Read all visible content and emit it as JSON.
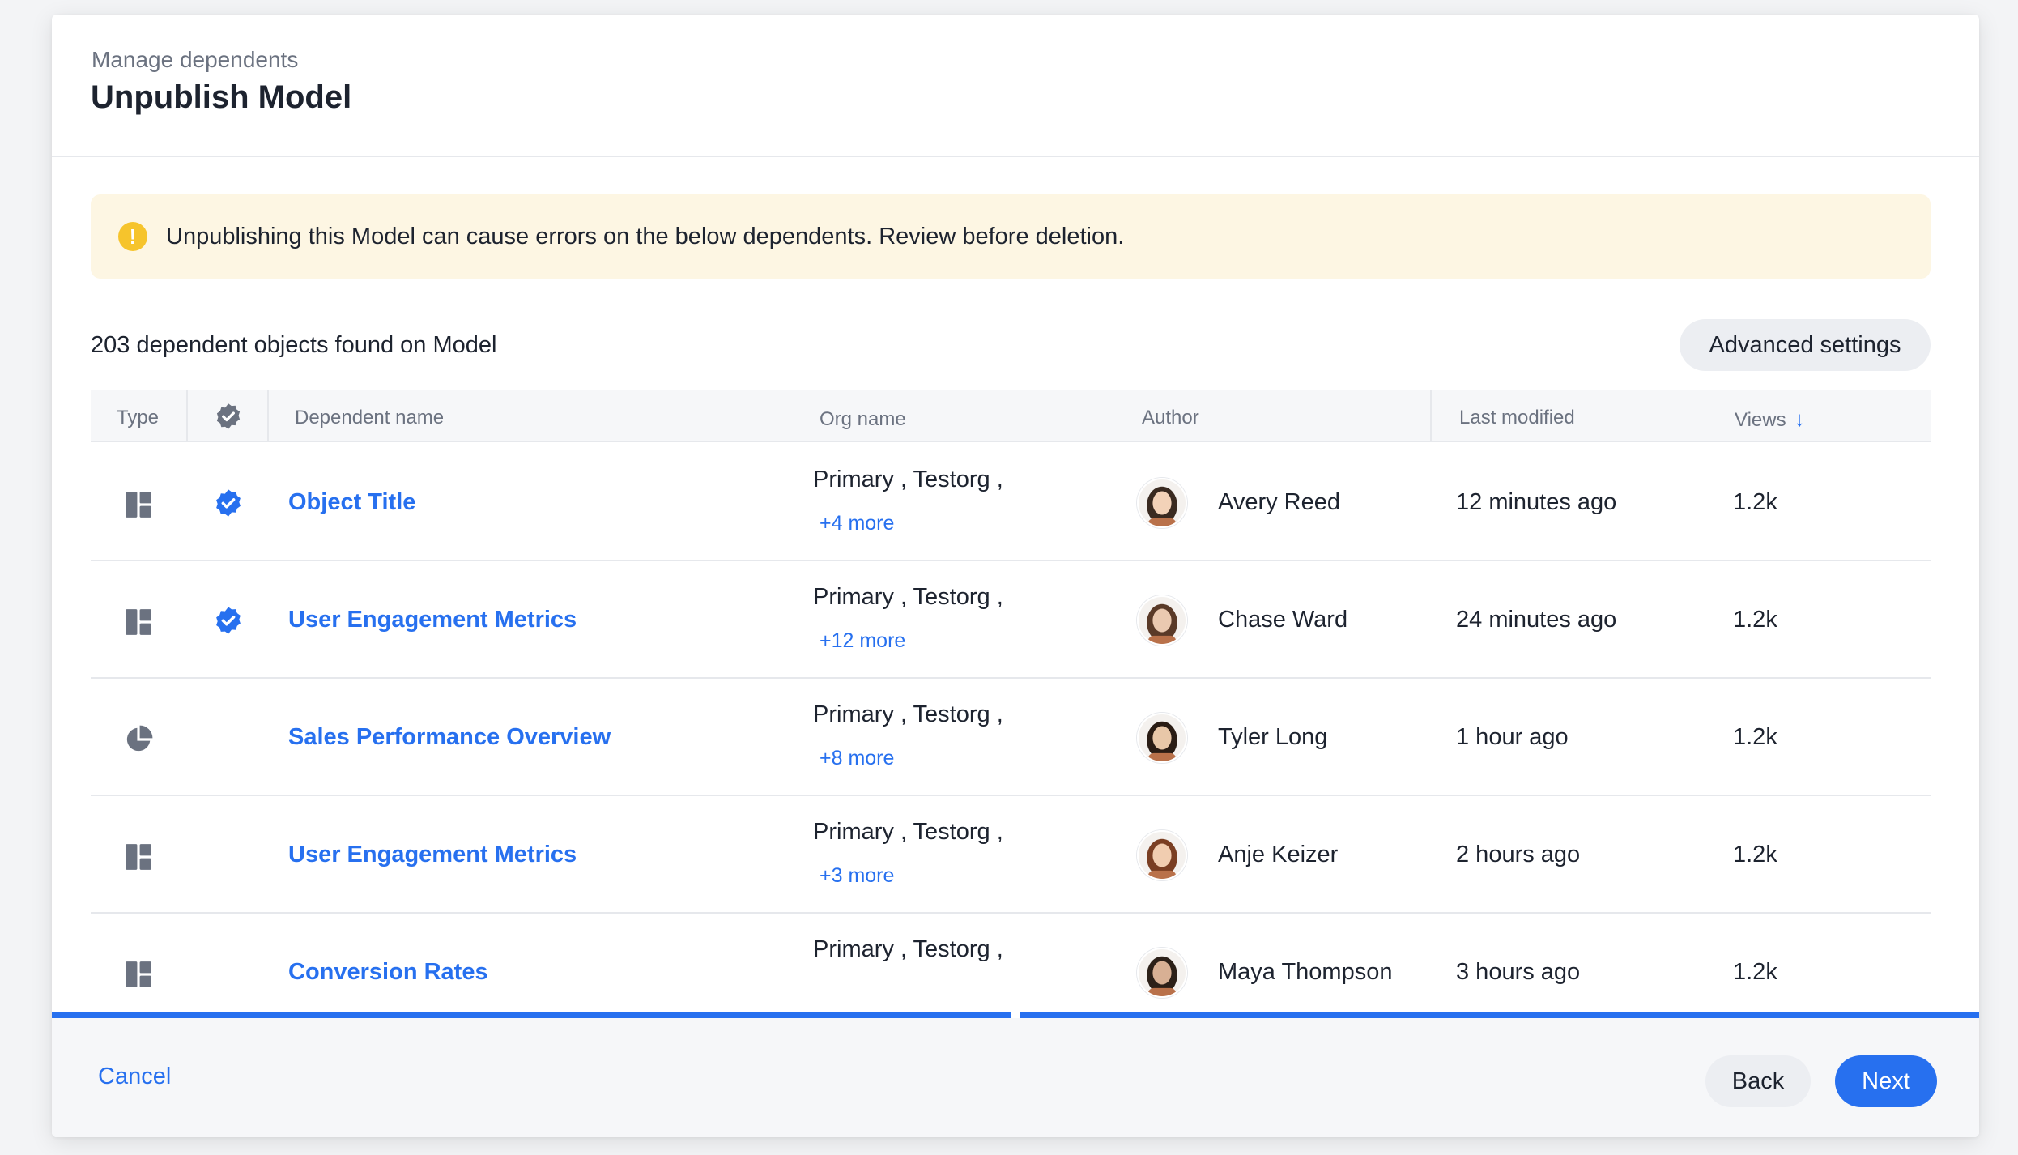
{
  "header": {
    "eyebrow": "Manage dependents",
    "title": "Unpublish Model"
  },
  "banner": {
    "icon": "warning-icon",
    "message": "Unpublishing this Model can cause errors on the below dependents. Review before deletion."
  },
  "summary": {
    "count_text": "203 dependent objects found on Model",
    "advanced_label": "Advanced settings"
  },
  "table": {
    "columns": {
      "type": "Type",
      "verified": "verified-badge-icon",
      "dependent_name": "Dependent name",
      "org_name": "Org name",
      "author": "Author",
      "last_modified": "Last modified",
      "views": "Views",
      "views_sort": "↓"
    },
    "rows": [
      {
        "type_icon": "liveboard-icon",
        "verified": true,
        "name": "Object Title",
        "orgs": "Primary , Testorg ,",
        "more": "+4 more",
        "author": "Avery Reed",
        "modified": "12 minutes ago",
        "views": "1.2k"
      },
      {
        "type_icon": "liveboard-icon",
        "verified": true,
        "name": "User Engagement Metrics",
        "orgs": "Primary , Testorg ,",
        "more": "+12 more",
        "author": "Chase Ward",
        "modified": "24 minutes ago",
        "views": "1.2k"
      },
      {
        "type_icon": "pie-chart-icon",
        "verified": false,
        "name": "Sales Performance Overview",
        "orgs": "Primary , Testorg ,",
        "more": "+8 more",
        "author": "Tyler Long",
        "modified": "1 hour ago",
        "views": "1.2k"
      },
      {
        "type_icon": "liveboard-icon",
        "verified": false,
        "name": "User Engagement Metrics",
        "orgs": "Primary , Testorg ,",
        "more": "+3 more",
        "author": "Anje Keizer",
        "modified": "2 hours ago",
        "views": "1.2k"
      },
      {
        "type_icon": "liveboard-icon",
        "verified": false,
        "name": "Conversion Rates",
        "orgs": "Primary , Testorg ,",
        "more": "",
        "author": "Maya Thompson",
        "modified": "3 hours ago",
        "views": "1.2k"
      }
    ]
  },
  "footer": {
    "cancel_label": "Cancel",
    "back_label": "Back",
    "next_label": "Next"
  },
  "colors": {
    "accent": "#2770ef",
    "banner_bg": "#fdf6e3",
    "warning": "#f6c42c"
  }
}
